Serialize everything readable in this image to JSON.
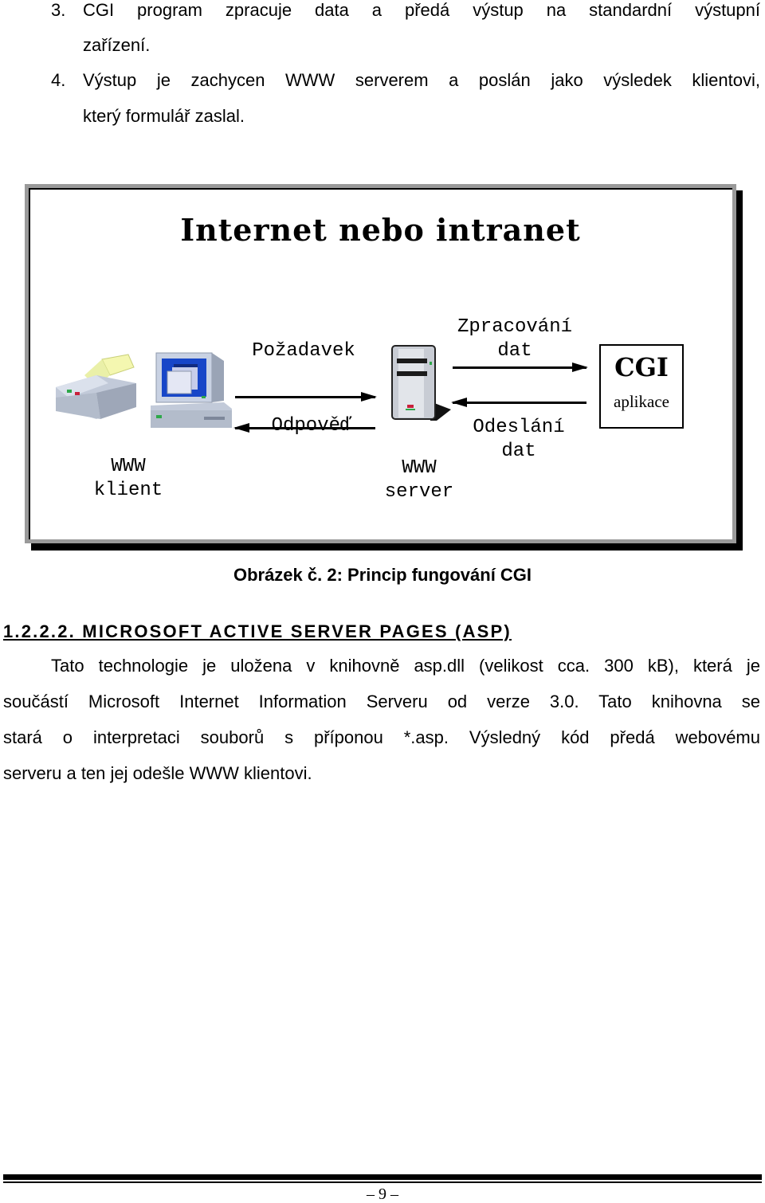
{
  "numbered_list": [
    {
      "number": "3.",
      "lines": [
        "CGI program zpracuje data a předá výstup na standardní výstupní",
        "zařízení."
      ]
    },
    {
      "number": "4.",
      "lines": [
        "Výstup je zachycen WWW serverem a poslán jako výsledek klientovi,",
        "který formulář zaslal."
      ]
    }
  ],
  "figure": {
    "title": "Internet nebo intranet",
    "client_label": [
      "WWW",
      "klient"
    ],
    "server_label": [
      "WWW",
      "server"
    ],
    "request_label": "Požadavek",
    "response_label": "Odpověď",
    "processing_label": [
      "Zpracování",
      "dat"
    ],
    "sending_label": [
      "Odeslání",
      "dat"
    ],
    "cgi_box": {
      "title": "CGI",
      "subtitle": "aplikace"
    },
    "caption": "Obrázek č. 2: Princip fungování CGI"
  },
  "section": {
    "heading": "1.2.2.2. MICROSOFT ACTIVE SERVER PAGES (ASP)",
    "paragraph_lines": [
      "Tato technologie je uložena v knihovně asp.dll (velikost cca. 300 kB), která je",
      "součástí Microsoft Internet Information Serveru od verze 3.0. Tato knihovna se",
      "stará o interpretaci souborů  s příponou *.asp. Výsledný kód předá webovému",
      "serveru a ten jej odešle WWW klientovi."
    ]
  },
  "footer": {
    "page_number": "– 9 –"
  }
}
